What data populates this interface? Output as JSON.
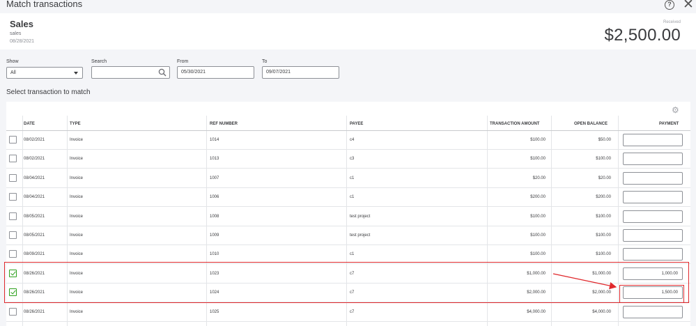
{
  "window": {
    "title": "Match transactions"
  },
  "header": {
    "title": "Sales",
    "subtitle": "sales",
    "date": "08/28/2021",
    "received_label": "Received",
    "amount": "$2,500.00"
  },
  "filters": {
    "show_label": "Show",
    "show_value": "All",
    "search_label": "Search",
    "search_value": "",
    "from_label": "From",
    "from_value": "05/30/2021",
    "to_label": "To",
    "to_value": "09/07/2021"
  },
  "table": {
    "caption": "Select transaction to match",
    "columns": {
      "date": "DATE",
      "type": "TYPE",
      "ref": "REF NUMBER",
      "payee": "PAYEE",
      "amount": "TRANSACTION AMOUNT",
      "balance": "OPEN BALANCE",
      "payment": "PAYMENT"
    },
    "rows": [
      {
        "checked": false,
        "date": "08/02/2021",
        "type": "Invoice",
        "ref": "1014",
        "payee": "c4",
        "amount": "$100.00",
        "balance": "$50.00",
        "payment": ""
      },
      {
        "checked": false,
        "date": "08/02/2021",
        "type": "Invoice",
        "ref": "1013",
        "payee": "c3",
        "amount": "$100.00",
        "balance": "$100.00",
        "payment": ""
      },
      {
        "checked": false,
        "date": "08/04/2021",
        "type": "Invoice",
        "ref": "1007",
        "payee": "c1",
        "amount": "$20.00",
        "balance": "$20.00",
        "payment": ""
      },
      {
        "checked": false,
        "date": "08/04/2021",
        "type": "Invoice",
        "ref": "1006",
        "payee": "c1",
        "amount": "$200.00",
        "balance": "$200.00",
        "payment": ""
      },
      {
        "checked": false,
        "date": "08/05/2021",
        "type": "Invoice",
        "ref": "1008",
        "payee": "test project",
        "amount": "$100.00",
        "balance": "$100.00",
        "payment": ""
      },
      {
        "checked": false,
        "date": "08/05/2021",
        "type": "Invoice",
        "ref": "1009",
        "payee": "test project",
        "amount": "$100.00",
        "balance": "$100.00",
        "payment": ""
      },
      {
        "checked": false,
        "date": "08/09/2021",
        "type": "Invoice",
        "ref": "1010",
        "payee": "c1",
        "amount": "$100.00",
        "balance": "$100.00",
        "payment": ""
      },
      {
        "checked": true,
        "date": "08/26/2021",
        "type": "Invoice",
        "ref": "1023",
        "payee": "c7",
        "amount": "$1,000.00",
        "balance": "$1,000.00",
        "payment": "1,000.00"
      },
      {
        "checked": true,
        "date": "08/26/2021",
        "type": "Invoice",
        "ref": "1024",
        "payee": "c7",
        "amount": "$2,000.00",
        "balance": "$2,000.00",
        "payment": "1,500.00"
      },
      {
        "checked": false,
        "date": "08/26/2021",
        "type": "Invoice",
        "ref": "1025",
        "payee": "c7",
        "amount": "$4,000.00",
        "balance": "$4,000.00",
        "payment": ""
      }
    ]
  },
  "colors": {
    "accent": "#2ca01c",
    "highlight": "#e0282c"
  },
  "icons": {
    "help": "help-icon",
    "close": "close-icon",
    "search": "search-icon",
    "gear": "gear-icon",
    "dropdown": "chevron-down-icon"
  }
}
